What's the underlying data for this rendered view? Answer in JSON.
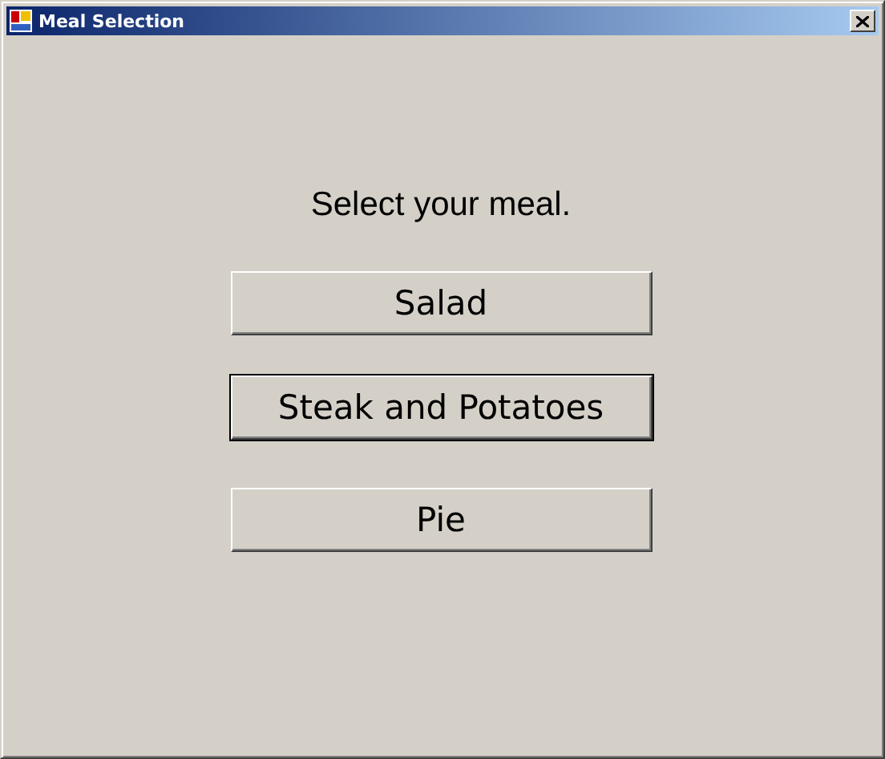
{
  "window": {
    "title": "Meal Selection"
  },
  "prompt": "Select your meal.",
  "buttons": [
    {
      "label": "Salad",
      "default": false
    },
    {
      "label": "Steak and Potatoes",
      "default": true
    },
    {
      "label": "Pie",
      "default": false
    }
  ]
}
